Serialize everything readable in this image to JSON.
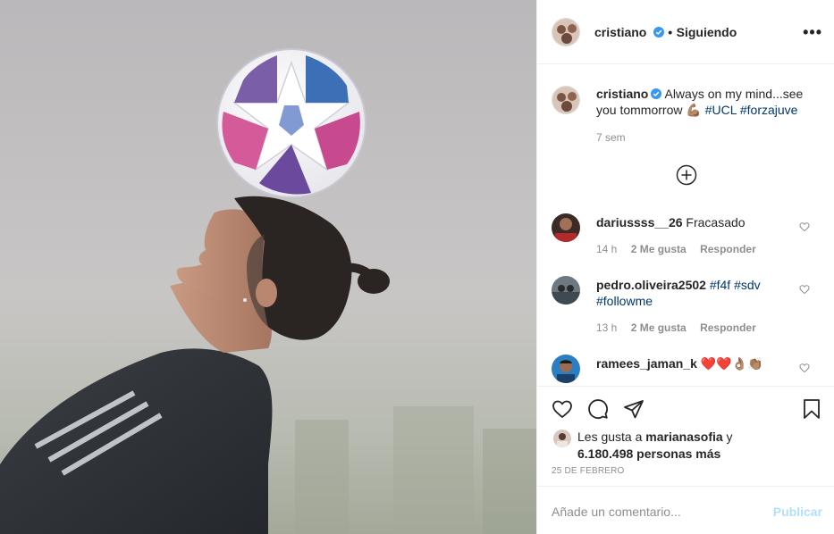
{
  "post": {
    "photo_alt": "photo",
    "author": {
      "username": "cristiano",
      "verified_icon": "verified-badge-icon",
      "separator": "•",
      "follow_status": "Siguiendo"
    },
    "more_icon": "more-options-icon",
    "more_label": "•••",
    "caption": {
      "username": "cristiano",
      "text": "Always on my mind...see you tommorrow",
      "emoji": "💪🏽",
      "hashtags": [
        "#UCL",
        "#forzajuve"
      ],
      "time": "7 sem"
    },
    "load_more_icon": "plus-circle-icon",
    "comments": [
      {
        "username": "dariussss__26",
        "text": "Fracasado",
        "time": "14 h",
        "likes": "2 Me gusta",
        "reply": "Responder"
      },
      {
        "username": "pedro.oliveira2502",
        "hashtags": [
          "#f4f",
          "#sdv",
          "#followme"
        ],
        "time": "13 h",
        "likes": "2 Me gusta",
        "reply": "Responder"
      },
      {
        "username": "ramees_jaman_k",
        "text": "❤️❤️👌🏽👏🏽"
      }
    ],
    "actions": {
      "like_icon": "heart-icon",
      "comment_icon": "comment-icon",
      "share_icon": "share-icon",
      "save_icon": "bookmark-icon"
    },
    "likes": {
      "prefix": "Les gusta a",
      "user": "marianasofia",
      "joiner": "y",
      "count": "6.180.498 personas más"
    },
    "date": "25 DE FEBRERO",
    "composer": {
      "placeholder": "Añade un comentario...",
      "publish_label": "Publicar"
    }
  },
  "colors": {
    "link": "#00376b",
    "muted": "#8e8e8e",
    "verified": "#3897f0",
    "publish_disabled": "#b2dffc"
  }
}
